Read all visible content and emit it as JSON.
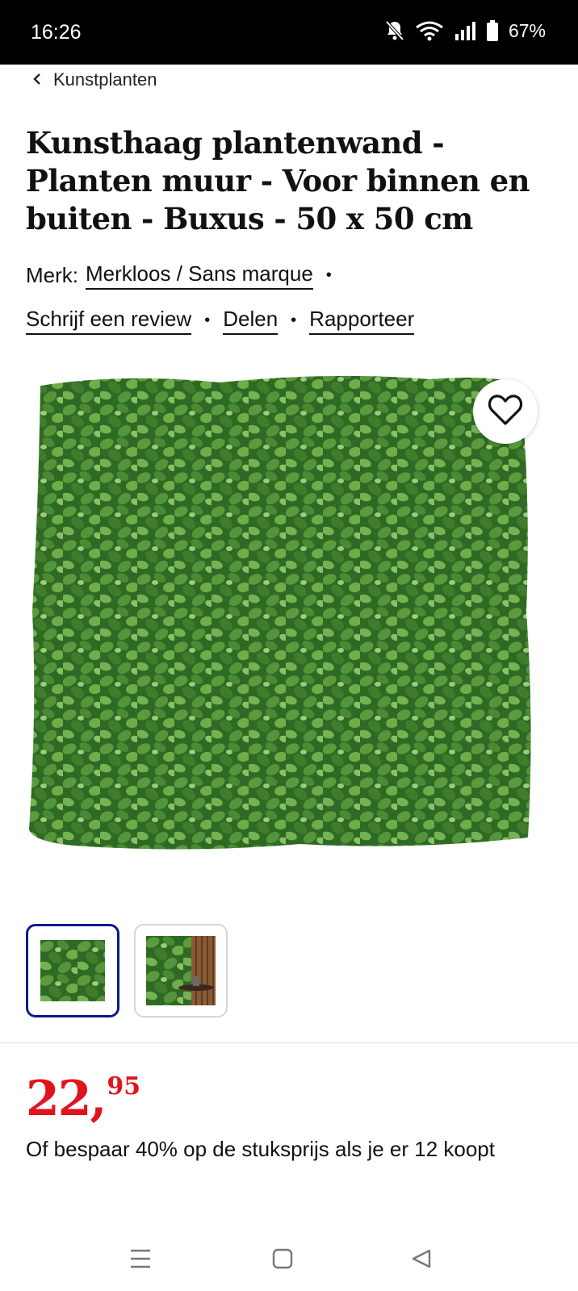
{
  "status_bar": {
    "time": "16:26",
    "battery": "67%"
  },
  "breadcrumb": {
    "label": "Kunstplanten"
  },
  "product": {
    "title": "Kunsthaag plantenwand - Planten muur - Voor binnen en buiten - Buxus - 50 x 50 cm",
    "brand_label": "Merk:",
    "brand_name": "Merkloos / Sans marque",
    "review_link": "Schrijf een review",
    "share_link": "Delen",
    "report_link": "Rapporteer",
    "separator": "•"
  },
  "price": {
    "main": "22,",
    "cents": "95"
  },
  "promo": "Of bespaar 40% op de stuksprijs als je er 12 koopt",
  "colors": {
    "price": "#e0141e",
    "thumb_selected": "#0a1a8a",
    "foliage": "#3d7a2c"
  },
  "icons": {
    "status": [
      "bell-off-icon",
      "wifi-icon",
      "signal-icon",
      "battery-icon"
    ],
    "nav": [
      "recents-icon",
      "home-icon",
      "back-icon"
    ]
  }
}
